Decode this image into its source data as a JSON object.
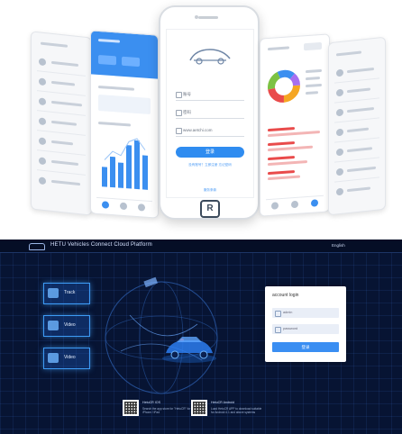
{
  "login_screen": {
    "username_placeholder": "账号",
    "password_placeholder": "密码",
    "website": "www.aetchi.com",
    "login_button": "登录",
    "register_text": "没有账号？立即注册 忘记密码",
    "bottom_link": "服务条款"
  },
  "platform": {
    "title": "HETU Vehicles Connect Cloud Platform",
    "language": "English",
    "features": [
      "Track",
      "Video",
      "Video"
    ],
    "login_card": {
      "title": "account login",
      "username": "admin",
      "password": "password",
      "button": "登录"
    },
    "downloads": [
      {
        "title": "HetuCR IOS",
        "desc": "Search the app store for \"HetuCR\" for iPhone / iPad"
      },
      {
        "title": "HetuCR Android",
        "desc": "Load HetuCR APP to download suitable for Android 4.1 and above systems"
      }
    ]
  },
  "colors": {
    "accent": "#2f8cf0",
    "dark_bg": "#071433",
    "glow": "#3d9bf5"
  }
}
